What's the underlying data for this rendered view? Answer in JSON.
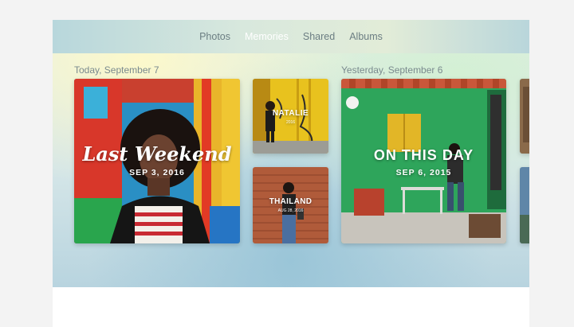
{
  "nav": {
    "tabs": [
      {
        "label": "Photos",
        "active": false
      },
      {
        "label": "Memories",
        "active": true
      },
      {
        "label": "Shared",
        "active": false
      },
      {
        "label": "Albums",
        "active": false
      }
    ]
  },
  "sections": [
    {
      "label": "Today, September 7"
    },
    {
      "label": "Yesterday, September 6"
    }
  ],
  "memories": {
    "last_weekend": {
      "title": "Last Weekend",
      "date": "SEP 3, 2016"
    },
    "natalie": {
      "title": "NATALIE",
      "date": "2016"
    },
    "thailand": {
      "title": "THAILAND",
      "date": "AUG 28, 2016"
    },
    "on_this_day": {
      "title": "ON THIS DAY",
      "date": "SEP 6, 2015"
    }
  },
  "colors": {
    "accent_active": "#ffffff",
    "tab_inactive": "#6b7d82"
  }
}
